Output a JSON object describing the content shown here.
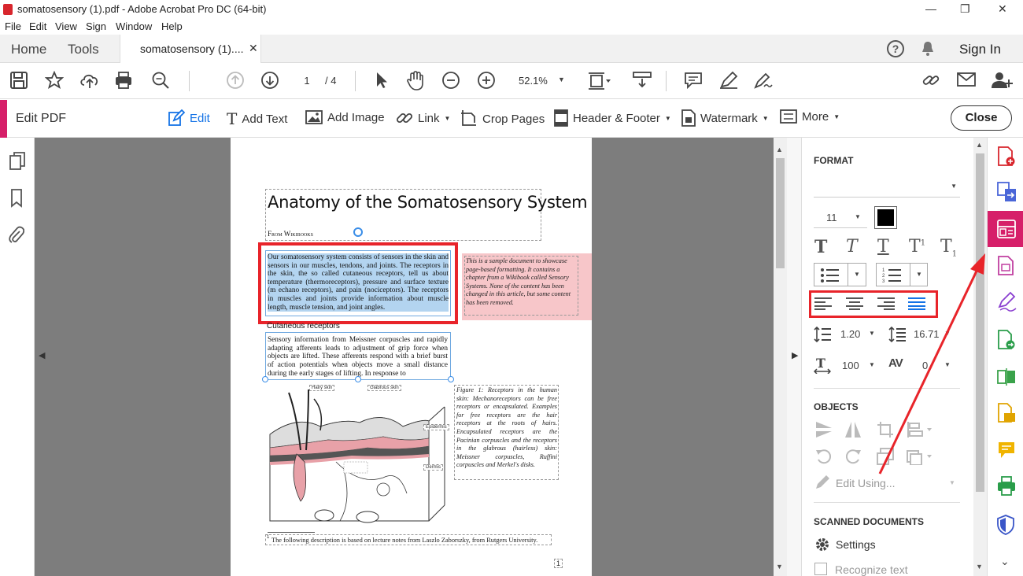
{
  "window": {
    "title": "somatosensory (1).pdf - Adobe Acrobat Pro DC (64-bit)"
  },
  "menu": [
    "File",
    "Edit",
    "View",
    "Sign",
    "Window",
    "Help"
  ],
  "tabs": {
    "home": "Home",
    "tools": "Tools",
    "document": "somatosensory (1)....",
    "sign_in": "Sign In"
  },
  "toolbar": {
    "page_current": "1",
    "page_total": "/ 4",
    "zoom": "52.1%"
  },
  "editbar": {
    "title": "Edit PDF",
    "items": [
      "Edit",
      "Add Text",
      "Add Image",
      "Link",
      "Crop Pages",
      "Header & Footer",
      "Watermark",
      "More"
    ],
    "close": "Close"
  },
  "document": {
    "title": "Anatomy of the Somatosensory System",
    "from": "From Wikibooks",
    "para1": "Our somatosensory system consists of sensors in the skin and sensors in our muscles, tendons, and joints. The receptors in the skin, the so called cutaneous receptors, tell us about temperature (thermoreceptors), pressure and surface texture (m echano receptors), and pain (nociceptors). The receptors in muscles and joints provide information about muscle length, muscle tension, and joint angles.",
    "note": "This is a sample document to showcase page-based formatting. It contains a chapter from a Wikibook called Sensory Systems. None of the content has been changed in this article, but some content has been removed.",
    "heading2": "Cutaneous receptors",
    "para2": "Sensory information from Meissner corpuscles and rapidly adapting afferents leads to adjustment of grip force when objects are lifted. These afferents respond with a brief burst of action potentials when objects move a small distance during the early stages of lifting. In response to",
    "figure_caption": "Figure 1: Receptors in the human skin: Mechanoreceptors can be free receptors or encapsulated. Examples for free receptors are the hair receptors at the roots of hairs. Encapsulated receptors are the Pacinian corpuscles and the receptors in the glabrous (hairless) skin: Meissner corpuscles, Ruffini corpuscles and Merkel's disks.",
    "footnote": "The following description is based on lecture notes from Laszlo Zaborszky, from Rutgers University.",
    "page_number": "1",
    "fig_labels": {
      "hairy": "Hairy skin",
      "glabrous": "Glabrous skin",
      "epidermis": "Epidermis",
      "dermis": "Dermis"
    }
  },
  "format_panel": {
    "header": "FORMAT",
    "font_size": "11",
    "line_spacing": "1.20",
    "para_spacing": "16.71",
    "h_scale": "100",
    "char_spacing": "0",
    "objects_header": "OBJECTS",
    "edit_using": "Edit Using...",
    "scanned_header": "SCANNED DOCUMENTS",
    "settings": "Settings",
    "recognize": "Recognize text"
  },
  "colors": {
    "accent": "#d61f69",
    "highlight": "#e8242a",
    "selection": "#b3d4f0",
    "note_bg": "#f7c6c9"
  }
}
